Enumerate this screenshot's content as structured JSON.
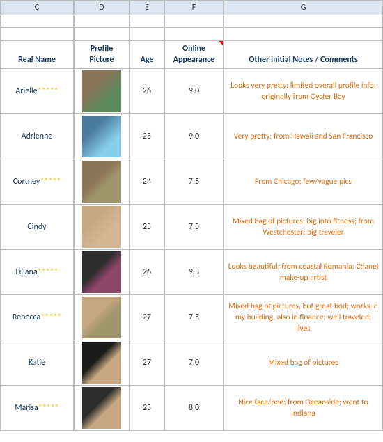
{
  "columns": {
    "c": "C",
    "d": "D",
    "e": "E",
    "f": "F",
    "g": "G"
  },
  "field_headers": {
    "real_name": "Real Name",
    "profile_picture": "Profile Picture",
    "age": "Age",
    "online_appearance": "Online Appearance",
    "notes": "Other Initial Notes / Comments"
  },
  "rows": [
    {
      "name": "Arielle",
      "stars": "*****",
      "age": "26",
      "score": "9.0",
      "notes": "Looks very pretty; limited overall profile info; originally from Oyster Bay",
      "photo_class": "photo-arielle"
    },
    {
      "name": "Adrienne",
      "stars": "",
      "age": "25",
      "score": "9.0",
      "notes": "Very pretty; from Hawaii and San Francisco",
      "photo_class": "photo-adrienne"
    },
    {
      "name": "Cortney",
      "stars": "*****",
      "age": "24",
      "score": "7.5",
      "notes": "From Chicago; few/vague pics",
      "photo_class": "photo-cortney"
    },
    {
      "name": "Cindy",
      "stars": "",
      "age": "25",
      "score": "7.5",
      "notes": "Mixed bag of pictures; big into fitness; from Westchester; big traveler",
      "photo_class": "photo-cindy"
    },
    {
      "name": "Liliana",
      "stars": "*****",
      "age": "26",
      "score": "9.5",
      "notes": "Looks beautiful; from coastal Romania; Chanel make-up artist",
      "photo_class": "photo-liliana"
    },
    {
      "name": "Rebecca",
      "stars": "*****",
      "age": "27",
      "score": "7.5",
      "notes": "Mixed bag of pictures, but great bod; works in my building, also in finance; well traveled; lives",
      "photo_class": "photo-rebecca"
    },
    {
      "name": "Katie",
      "stars": "",
      "age": "27",
      "score": "7.0",
      "notes": "Mixed bag of pictures",
      "photo_class": "photo-katie"
    },
    {
      "name": "Marisa",
      "stars": "*****",
      "age": "25",
      "score": "8.0",
      "notes": "Nice face/bod; from Oceanside; went to Indiana",
      "photo_class": "photo-marisa"
    }
  ]
}
